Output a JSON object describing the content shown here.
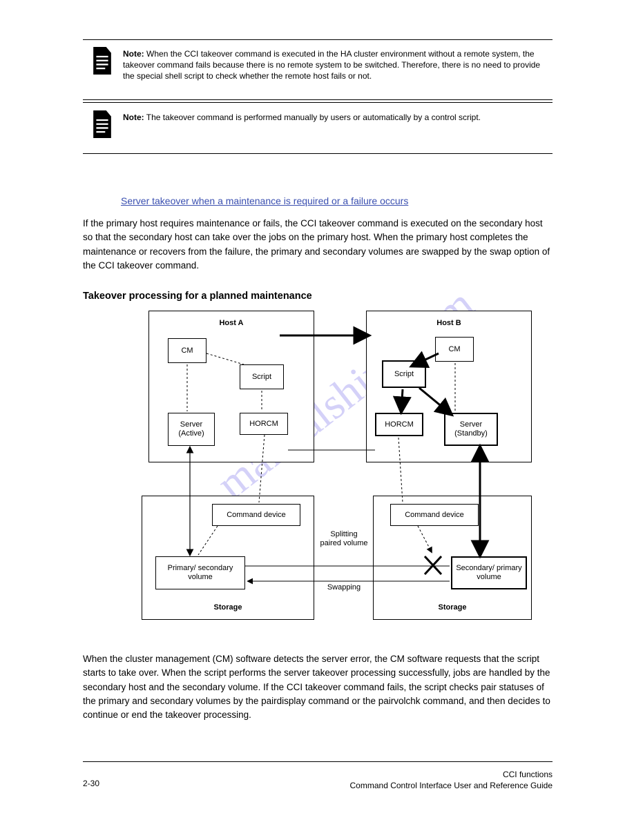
{
  "note1_label": "Note:",
  "note1_body": "When the CCI takeover command is executed in the HA cluster environment without a remote system, the takeover command fails because there is no remote system to be switched. Therefore, there is no need to provide the special shell script to check whether the remote host fails or not.",
  "note2_label": "Note:",
  "note2_body": "The takeover command is performed manually by users or automatically by a control script.",
  "heading": "Server takeover when a maintenance is required or a failure occurs",
  "p1": "If the primary host requires maintenance or fails, the CCI takeover command is executed on the secondary host so that the secondary host can take over the jobs on the primary host. When the primary host completes the maintenance or recovers from the failure, the primary and secondary volumes are swapped by the swap option of the CCI takeover command.",
  "subhead": "Takeover processing for a planned maintenance",
  "p2": "When the cluster management (CM) software detects the server error, the CM software requests that the script starts to take over. When the script performs the server takeover processing successfully, jobs are handled by the secondary host and the secondary volume. If the CCI takeover command fails, the script checks pair statuses of the primary and secondary volumes by the pairdisplay command or the pairvolchk command, and then decides to continue or end the takeover processing.",
  "d": {
    "hosta": "Host A",
    "hostb": "Host B",
    "cm": "CM",
    "script": "Script",
    "horcm": "HORCM",
    "serverA": "Server (Active)",
    "serverB": "Server (Standby)",
    "cmdd": "Command device",
    "storage": "Storage",
    "pvol": "Primary/ secondary volume",
    "svol": "Secondary/ primary volume",
    "split": "Splitting paired volume",
    "swap": "Swapping"
  },
  "foot_left": "2-30",
  "foot_r1": "CCI functions",
  "foot_r2": "Command Control Interface User and Reference Guide",
  "watermark": "manualshive.com"
}
